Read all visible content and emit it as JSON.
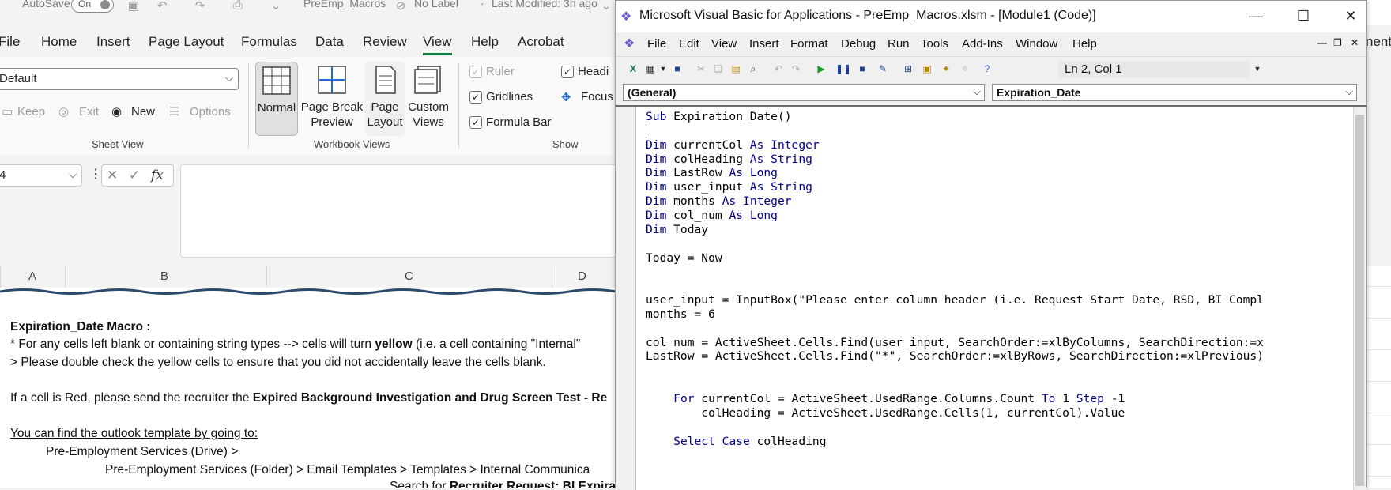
{
  "excel": {
    "titlebar": {
      "autosave_label": "AutoSave",
      "autosave_state": "On",
      "doc_name": "PreEmp_Macros",
      "label_status": "No Label",
      "modified": "Last Modified: 3h ago"
    },
    "menu": [
      "File",
      "Home",
      "Insert",
      "Page Layout",
      "Formulas",
      "Data",
      "Review",
      "View",
      "Help",
      "Acrobat"
    ],
    "active_menu": "View",
    "sheet_view": {
      "select_value": "Default",
      "keep": "Keep",
      "exit": "Exit",
      "new": "New",
      "options": "Options",
      "group_label": "Sheet View"
    },
    "workbook_views": {
      "normal": "Normal",
      "page_break_1": "Page Break",
      "page_break_2": "Preview",
      "page_layout_1": "Page",
      "page_layout_2": "Layout",
      "custom_1": "Custom",
      "custom_2": "Views",
      "group_label": "Workbook Views"
    },
    "show": {
      "ruler": "Ruler",
      "gridlines": "Gridlines",
      "formula_bar": "Formula Bar",
      "headings": "Headi",
      "focus": "Focus",
      "group_label": "Show"
    },
    "namebox_value": "4",
    "fx_symbol": "fx",
    "columns": [
      "A",
      "B",
      "C",
      "D"
    ],
    "right_edge_text": "nent",
    "sheet_text": {
      "line1": "Expiration_Date Macro :",
      "line2a": "* For any cells left blank or containing string types --> cells will turn ",
      "line2b": "yellow",
      "line2c": " (i.e. a cell containing \"Internal\"",
      "line3": "> Please double check the yellow cells to ensure that you did not accidentally leave the cells blank.",
      "line4a": "If a cell is Red, please send the recruiter the ",
      "line4b": "Expired Background Investigation and Drug Screen Test - Re",
      "line5": "You can find the outlook template by going to:",
      "line6": "Pre-Employment Services (Drive) >",
      "line7": "Pre-Employment Services (Folder) > Email Templates > Templates > Internal Communica",
      "line8a": "Search for ",
      "line8b": "Recruiter Request: BI Expira"
    }
  },
  "vba": {
    "title": "Microsoft Visual Basic for Applications - PreEmp_Macros.xlsm - [Module1 (Code)]",
    "menu": [
      "File",
      "Edit",
      "View",
      "Insert",
      "Format",
      "Debug",
      "Run",
      "Tools",
      "Add-Ins",
      "Window",
      "Help"
    ],
    "position": "Ln 2, Col 1",
    "object_combo": "(General)",
    "proc_combo": "Expiration_Date",
    "code": [
      "Sub Expiration_Date()",
      "",
      "Dim currentCol As Integer",
      "Dim colHeading As String",
      "Dim LastRow As Long",
      "Dim user_input As String",
      "Dim months As Integer",
      "Dim col_num As Long",
      "Dim Today",
      "",
      "Today = Now",
      "",
      "",
      "user_input = InputBox(\"Please enter column header (i.e. Request Start Date, RSD, BI Compl",
      "months = 6",
      "",
      "col_num = ActiveSheet.Cells.Find(user_input, SearchOrder:=xlByColumns, SearchDirection:=x",
      "LastRow = ActiveSheet.Cells.Find(\"*\", SearchOrder:=xlByRows, SearchDirection:=xlPrevious)",
      "",
      "",
      "    For currentCol = ActiveSheet.UsedRange.Columns.Count To 1 Step -1",
      "        colHeading = ActiveSheet.UsedRange.Cells(1, currentCol).Value",
      "",
      "    Select Case colHeading"
    ]
  }
}
